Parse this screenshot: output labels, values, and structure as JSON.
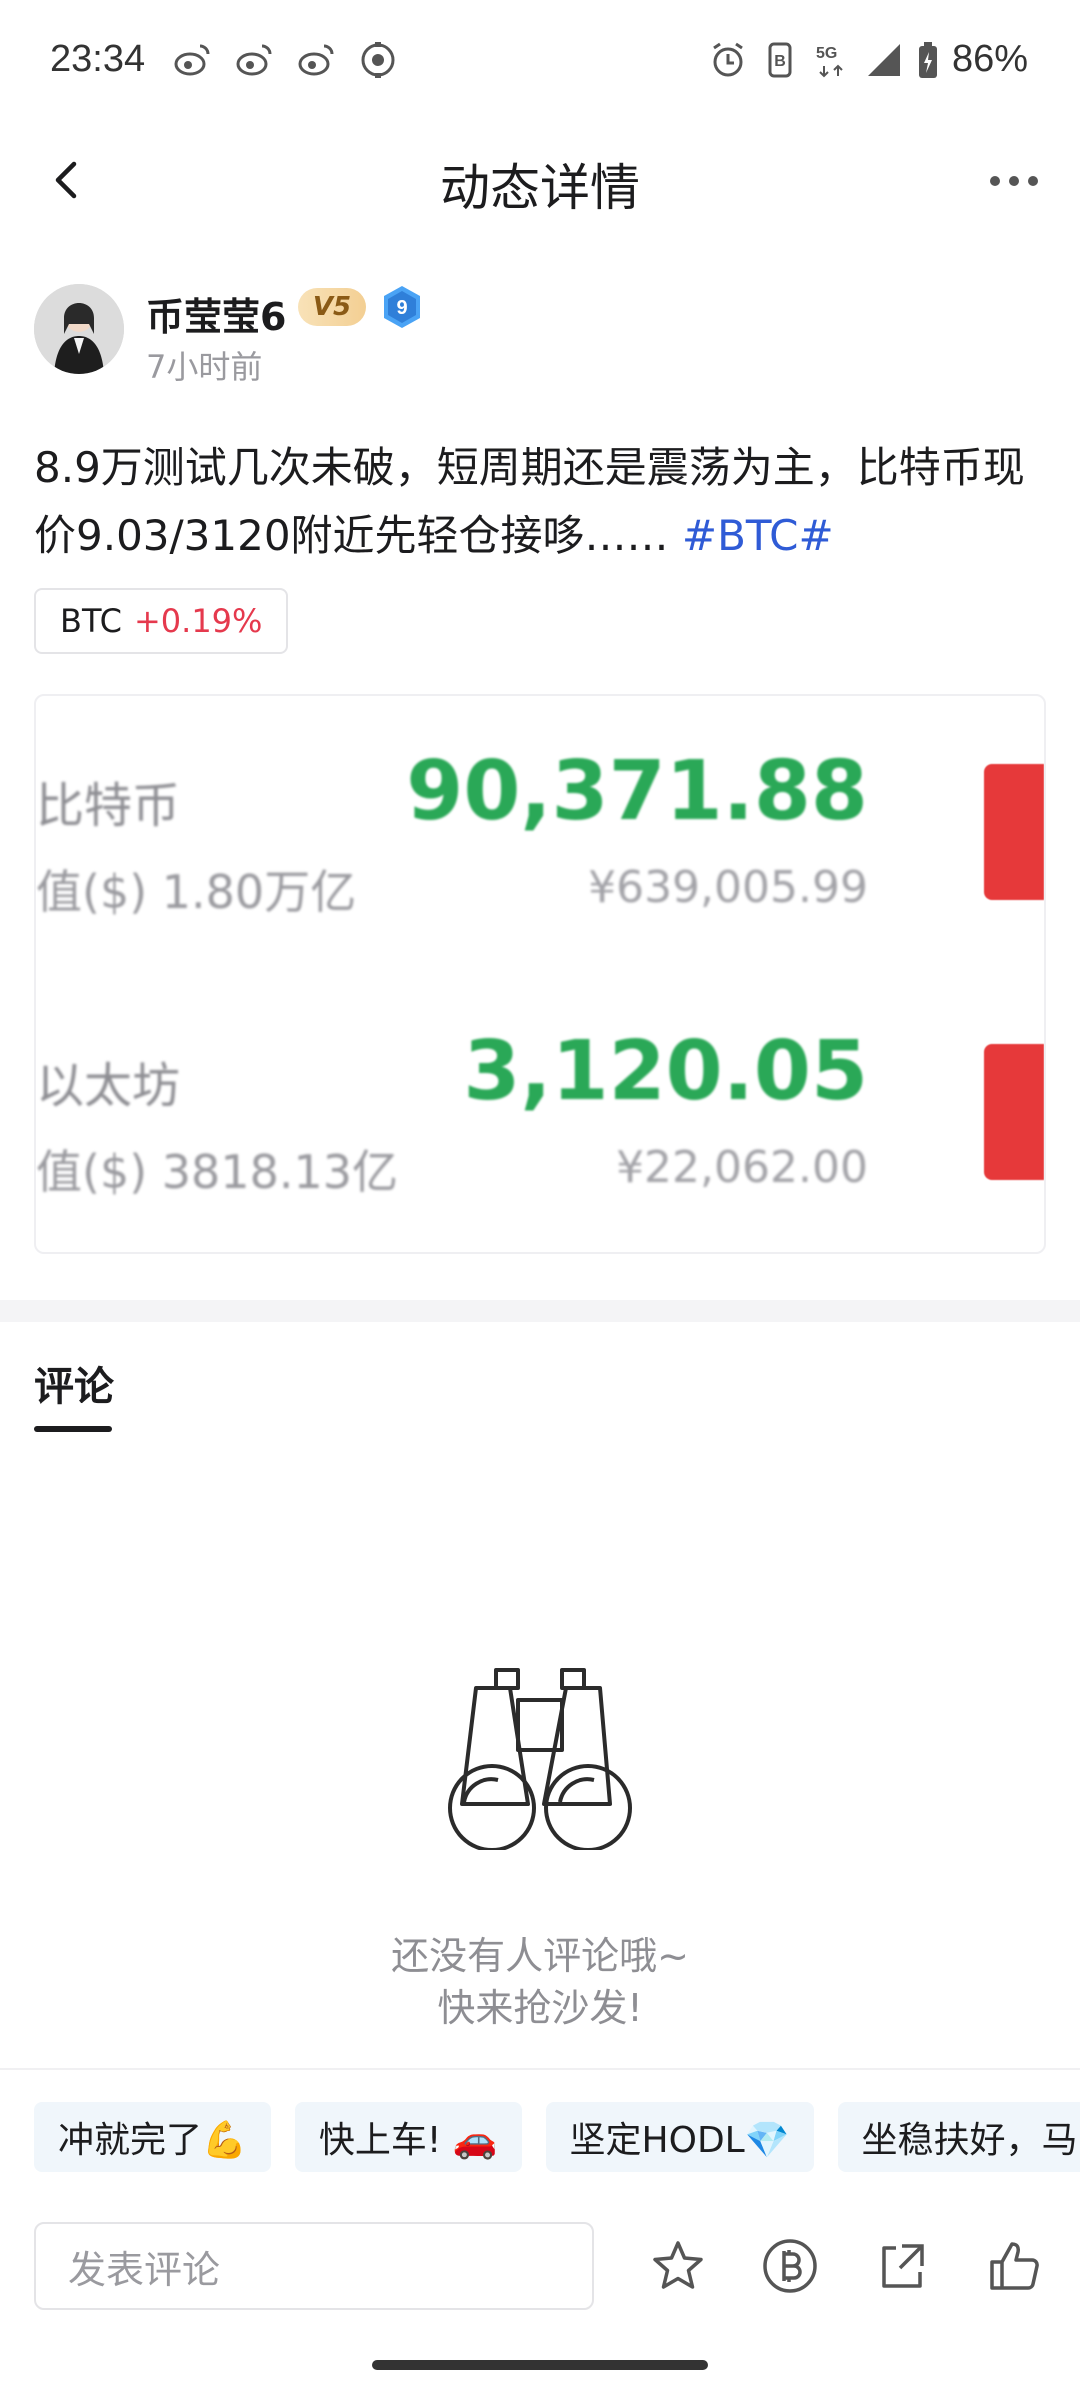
{
  "status_bar": {
    "time": "23:34",
    "left_icons": [
      "weibo-icon",
      "weibo-icon",
      "weibo-icon",
      "camera-icon"
    ],
    "right_icons": [
      "alarm-icon",
      "nfc-icon",
      "5g-icon",
      "signal-icon",
      "battery-charging-icon"
    ],
    "battery": "86%"
  },
  "header": {
    "title": "动态详情"
  },
  "post": {
    "author": "币莹莹6",
    "vip_level": "V5",
    "user_level": "9",
    "time_ago": "7小时前",
    "text": "8.9万测试几次未破，短周期还是震荡为主，比特币现价9.03/3120附近先轻仓接哆……",
    "hashtag": "#BTC#",
    "coin_chip": {
      "symbol": "BTC",
      "change": "+0.19%"
    }
  },
  "image_card": {
    "rows": [
      {
        "name": "比特币",
        "market_cap": "值($) 1.80万亿",
        "price": "90,371.88",
        "price_cny": "¥639,005.99"
      },
      {
        "name": "以太坊",
        "market_cap": "值($) 3818.13亿",
        "price": "3,120.05",
        "price_cny": "¥22,062.00"
      }
    ]
  },
  "comments": {
    "tab_label": "评论",
    "empty_line1": "还没有人评论哦~",
    "empty_line2": "快来抢沙发!"
  },
  "quick_replies": [
    "冲就完了💪",
    "快上车! 🚗",
    "坚定HODL💎",
    "坐稳扶好，马"
  ],
  "bottom_bar": {
    "input_placeholder": "发表评论",
    "actions": [
      "star-icon",
      "tip-coin-icon",
      "share-icon",
      "like-icon"
    ]
  },
  "colors": {
    "hashtag": "#2f5bd6",
    "positive_change": "#e5394d",
    "price_green": "#2aa857",
    "trade_red": "#e6393a"
  }
}
